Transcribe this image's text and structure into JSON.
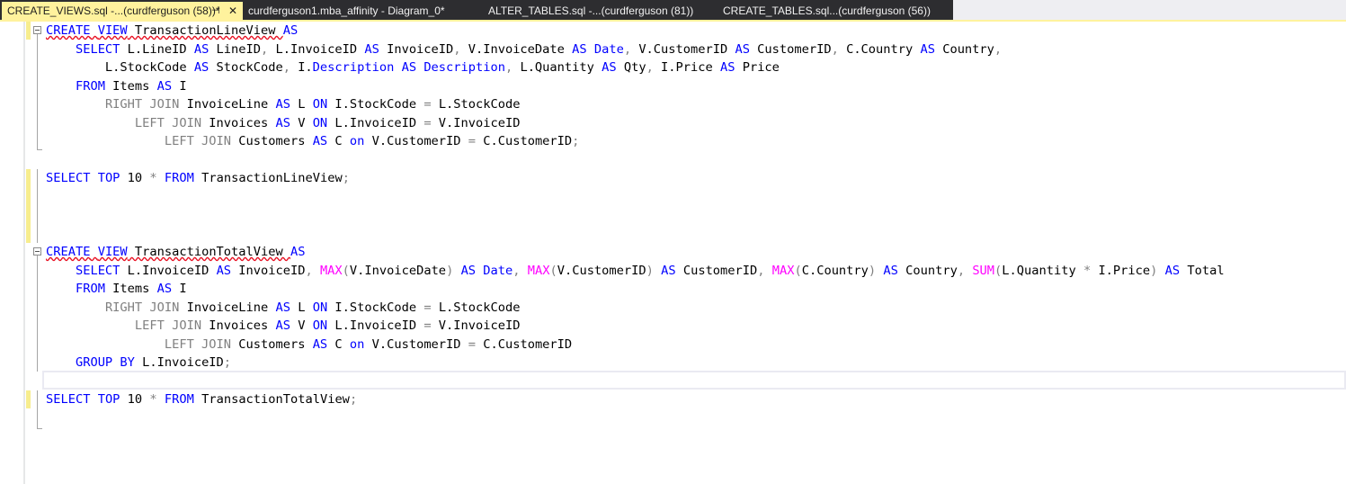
{
  "tabs": [
    {
      "label": "CREATE_VIEWS.sql -...(curdferguson (58))*",
      "active": true,
      "pin_glyph": "⊣",
      "close_glyph": "✕"
    },
    {
      "label": "curdferguson1.mba_affinity - Diagram_0*",
      "active": false
    },
    {
      "label": "ALTER_TABLES.sql -...(curdferguson (81))",
      "active": false
    },
    {
      "label": "CREATE_TABLES.sql...(curdferguson (56))",
      "active": false
    }
  ],
  "colors": {
    "active_tab": "#fff29d",
    "tab_strip": "#2d2d30",
    "keyword": "#0000ff",
    "operator": "#808080",
    "function": "#ff00ff",
    "change_marker": "#f7ed8e"
  },
  "code": {
    "lines": [
      [
        [
          "k sq",
          "CREATE"
        ],
        [
          "sq",
          " "
        ],
        [
          "k sq",
          "VIEW"
        ],
        [
          "sq",
          " TransactionLineView "
        ],
        [
          "k",
          "AS"
        ]
      ],
      [
        [
          "",
          "    "
        ],
        [
          "k",
          "SELECT"
        ],
        [
          "",
          " L.LineID "
        ],
        [
          "k",
          "AS"
        ],
        [
          "",
          " LineID"
        ],
        [
          "g",
          ", "
        ],
        [
          "",
          "L.InvoiceID "
        ],
        [
          "k",
          "AS"
        ],
        [
          "",
          " InvoiceID"
        ],
        [
          "g",
          ", "
        ],
        [
          "",
          "V.InvoiceDate "
        ],
        [
          "k",
          "AS"
        ],
        [
          "",
          " "
        ],
        [
          "k",
          "Date"
        ],
        [
          "g",
          ", "
        ],
        [
          "",
          "V.CustomerID "
        ],
        [
          "k",
          "AS"
        ],
        [
          "",
          " CustomerID"
        ],
        [
          "g",
          ", "
        ],
        [
          "",
          "C.Country "
        ],
        [
          "k",
          "AS"
        ],
        [
          "",
          " Country"
        ],
        [
          "g",
          ","
        ]
      ],
      [
        [
          "",
          "        L.StockCode "
        ],
        [
          "k",
          "AS"
        ],
        [
          "",
          " StockCode"
        ],
        [
          "g",
          ", "
        ],
        [
          "",
          "I."
        ],
        [
          "k",
          "Description"
        ],
        [
          "",
          " "
        ],
        [
          "k",
          "AS"
        ],
        [
          "",
          " "
        ],
        [
          "k",
          "Description"
        ],
        [
          "g",
          ", "
        ],
        [
          "",
          "L.Quantity "
        ],
        [
          "k",
          "AS"
        ],
        [
          "",
          " Qty"
        ],
        [
          "g",
          ", "
        ],
        [
          "",
          "I.Price "
        ],
        [
          "k",
          "AS"
        ],
        [
          "",
          " Price"
        ]
      ],
      [
        [
          "",
          "    "
        ],
        [
          "k",
          "FROM"
        ],
        [
          "",
          " Items "
        ],
        [
          "k",
          "AS"
        ],
        [
          "",
          " I"
        ]
      ],
      [
        [
          "",
          "        "
        ],
        [
          "g",
          "RIGHT JOIN"
        ],
        [
          "",
          " InvoiceLine "
        ],
        [
          "k",
          "AS"
        ],
        [
          "",
          " L "
        ],
        [
          "k",
          "ON"
        ],
        [
          "",
          " I.StockCode "
        ],
        [
          "g",
          "="
        ],
        [
          "",
          " L.StockCode"
        ]
      ],
      [
        [
          "",
          "            "
        ],
        [
          "g",
          "LEFT JOIN"
        ],
        [
          "",
          " Invoices "
        ],
        [
          "k",
          "AS"
        ],
        [
          "",
          " V "
        ],
        [
          "k",
          "ON"
        ],
        [
          "",
          " L.InvoiceID "
        ],
        [
          "g",
          "="
        ],
        [
          "",
          " V.InvoiceID"
        ]
      ],
      [
        [
          "",
          "                "
        ],
        [
          "g",
          "LEFT JOIN"
        ],
        [
          "",
          " Customers "
        ],
        [
          "k",
          "AS"
        ],
        [
          "",
          " C "
        ],
        [
          "k",
          "on"
        ],
        [
          "",
          " V.CustomerID "
        ],
        [
          "g",
          "="
        ],
        [
          "",
          " C.CustomerID"
        ],
        [
          "g",
          ";"
        ]
      ],
      [],
      [
        [
          "k",
          "SELECT"
        ],
        [
          "",
          " "
        ],
        [
          "k",
          "TOP"
        ],
        [
          "",
          " 10 "
        ],
        [
          "g",
          "*"
        ],
        [
          "",
          " "
        ],
        [
          "k",
          "FROM"
        ],
        [
          "",
          " TransactionLineView"
        ],
        [
          "g",
          ";"
        ]
      ],
      [],
      [],
      [],
      [
        [
          "k sq",
          "CREATE"
        ],
        [
          "sq",
          " "
        ],
        [
          "k sq",
          "VIEW"
        ],
        [
          "sq",
          " TransactionTotalView "
        ],
        [
          "k",
          "AS"
        ]
      ],
      [
        [
          "",
          "    "
        ],
        [
          "k",
          "SELECT"
        ],
        [
          "",
          " L.InvoiceID "
        ],
        [
          "k",
          "AS"
        ],
        [
          "",
          " InvoiceID"
        ],
        [
          "g",
          ", "
        ],
        [
          "f",
          "MAX"
        ],
        [
          "g",
          "("
        ],
        [
          "",
          "V.InvoiceDate"
        ],
        [
          "g",
          ")"
        ],
        [
          "",
          " "
        ],
        [
          "k",
          "AS"
        ],
        [
          "",
          " "
        ],
        [
          "k",
          "Date"
        ],
        [
          "g",
          ", "
        ],
        [
          "f",
          "MAX"
        ],
        [
          "g",
          "("
        ],
        [
          "",
          "V.CustomerID"
        ],
        [
          "g",
          ")"
        ],
        [
          "",
          " "
        ],
        [
          "k",
          "AS"
        ],
        [
          "",
          " CustomerID"
        ],
        [
          "g",
          ", "
        ],
        [
          "f",
          "MAX"
        ],
        [
          "g",
          "("
        ],
        [
          "",
          "C.Country"
        ],
        [
          "g",
          ")"
        ],
        [
          "",
          " "
        ],
        [
          "k",
          "AS"
        ],
        [
          "",
          " Country"
        ],
        [
          "g",
          ", "
        ],
        [
          "f",
          "SUM"
        ],
        [
          "g",
          "("
        ],
        [
          "",
          "L.Quantity "
        ],
        [
          "g",
          "*"
        ],
        [
          "",
          " I.Price"
        ],
        [
          "g",
          ")"
        ],
        [
          "",
          " "
        ],
        [
          "k",
          "AS"
        ],
        [
          "",
          " Total"
        ]
      ],
      [
        [
          "",
          "    "
        ],
        [
          "k",
          "FROM"
        ],
        [
          "",
          " Items "
        ],
        [
          "k",
          "AS"
        ],
        [
          "",
          " I"
        ]
      ],
      [
        [
          "",
          "        "
        ],
        [
          "g",
          "RIGHT JOIN"
        ],
        [
          "",
          " InvoiceLine "
        ],
        [
          "k",
          "AS"
        ],
        [
          "",
          " L "
        ],
        [
          "k",
          "ON"
        ],
        [
          "",
          " I.StockCode "
        ],
        [
          "g",
          "="
        ],
        [
          "",
          " L.StockCode"
        ]
      ],
      [
        [
          "",
          "            "
        ],
        [
          "g",
          "LEFT JOIN"
        ],
        [
          "",
          " Invoices "
        ],
        [
          "k",
          "AS"
        ],
        [
          "",
          " V "
        ],
        [
          "k",
          "ON"
        ],
        [
          "",
          " L.InvoiceID "
        ],
        [
          "g",
          "="
        ],
        [
          "",
          " V.InvoiceID"
        ]
      ],
      [
        [
          "",
          "                "
        ],
        [
          "g",
          "LEFT JOIN"
        ],
        [
          "",
          " Customers "
        ],
        [
          "k",
          "AS"
        ],
        [
          "",
          " C "
        ],
        [
          "k",
          "on"
        ],
        [
          "",
          " V.CustomerID "
        ],
        [
          "g",
          "="
        ],
        [
          "",
          " C.CustomerID"
        ]
      ],
      [
        [
          "",
          "    "
        ],
        [
          "k",
          "GROUP BY"
        ],
        [
          "",
          " L.InvoiceID"
        ],
        [
          "g",
          ";"
        ]
      ],
      [],
      [
        [
          "k",
          "SELECT"
        ],
        [
          "",
          " "
        ],
        [
          "k",
          "TOP"
        ],
        [
          "",
          " 10 "
        ],
        [
          "g",
          "*"
        ],
        [
          "",
          " "
        ],
        [
          "k",
          "FROM"
        ],
        [
          "",
          " TransactionTotalView"
        ],
        [
          "g",
          ";"
        ]
      ]
    ]
  }
}
